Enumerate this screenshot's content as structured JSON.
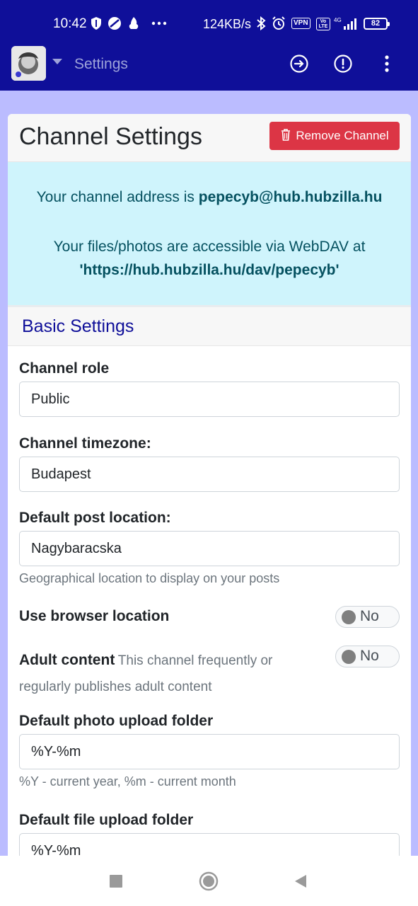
{
  "status_bar": {
    "time": "10:42",
    "network_speed": "124KB/s",
    "vpn_badge": "VPN",
    "volte_badge": "Vo LTE",
    "signal_label": "4G",
    "battery": "82"
  },
  "app_bar": {
    "title": "Settings",
    "icons": [
      "avatar",
      "dropdown-caret",
      "logout-icon",
      "alert-icon",
      "more-vert-icon"
    ]
  },
  "card": {
    "title": "Channel Settings",
    "remove_label": "Remove Channel"
  },
  "info": {
    "address_prefix": "Your channel address is ",
    "address": "pepecyb@hub.hubzilla.hu",
    "webdav_prefix": "Your files/photos are accessible via WebDAV at",
    "webdav_url": "'https://hub.hubzilla.hu/dav/pepecyb'"
  },
  "basic": {
    "section_title": "Basic Settings",
    "channel_role_label": "Channel role",
    "channel_role_value": "Public",
    "timezone_label": "Channel timezone:",
    "timezone_value": "Budapest",
    "location_label": "Default post location:",
    "location_value": "Nagybaracska",
    "location_help": "Geographical location to display on your posts",
    "browser_location_label": "Use browser location",
    "browser_location_value": "No",
    "adult_label": "Adult content",
    "adult_desc_1": "This channel frequently or",
    "adult_desc_2": "regularly publishes adult content",
    "adult_value": "No",
    "photo_folder_label": "Default photo upload folder",
    "photo_folder_value": "%Y-%m",
    "photo_folder_help": "%Y - current year, %m - current month",
    "file_folder_label": "Default file upload folder",
    "file_folder_value": "%Y-%m"
  },
  "colors": {
    "primary": "#0f0f99",
    "danger": "#dc3545",
    "info_bg": "#cff4fc",
    "info_text": "#055160",
    "page_bg": "#bbbcff"
  }
}
